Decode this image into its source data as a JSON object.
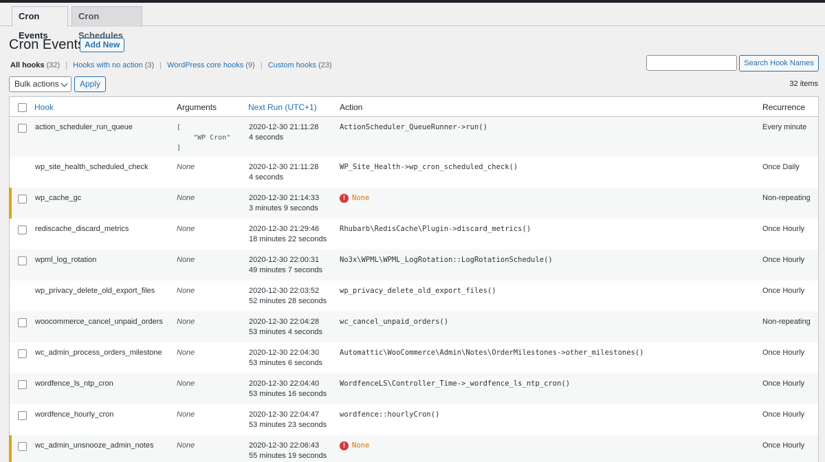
{
  "tabs": [
    {
      "label": "Cron Events",
      "active": true
    },
    {
      "label": "Cron Schedules",
      "active": false
    }
  ],
  "page": {
    "title": "Cron Events",
    "add_new": "Add New"
  },
  "filters": [
    {
      "label": "All hooks",
      "count": "(32)"
    },
    {
      "label": "Hooks with no action",
      "count": "(3)"
    },
    {
      "label": "WordPress core hooks",
      "count": "(9)"
    },
    {
      "label": "Custom hooks",
      "count": "(23)"
    }
  ],
  "search": {
    "button": "Search Hook Names",
    "value": ""
  },
  "bulk": {
    "label": "Bulk actions",
    "apply": "Apply"
  },
  "items_count": "32 items",
  "columns": {
    "hook": "Hook",
    "arguments": "Arguments",
    "next_run": "Next Run (UTC+1)",
    "action": "Action",
    "recurrence": "Recurrence"
  },
  "rows": [
    {
      "hook": "action_scheduler_run_queue",
      "args": "[\n    \"WP Cron\"\n]",
      "args_mono": true,
      "run": "2020-12-30 21:11:28",
      "rel": "4 seconds",
      "action": "ActionScheduler_QueueRunner->run()",
      "warn": false,
      "rec": "Every minute",
      "checkbox": true
    },
    {
      "hook": "wp_site_health_scheduled_check",
      "args": "None",
      "run": "2020-12-30 21:11:28",
      "rel": "4 seconds",
      "action": "WP_Site_Health->wp_cron_scheduled_check()",
      "warn": false,
      "rec": "Once Daily",
      "checkbox": false
    },
    {
      "hook": "wp_cache_gc",
      "args": "None",
      "run": "2020-12-30 21:14:33",
      "rel": "3 minutes 9 seconds",
      "action": "None",
      "warn": true,
      "rec": "Non-repeating",
      "checkbox": true
    },
    {
      "hook": "rediscache_discard_metrics",
      "args": "None",
      "run": "2020-12-30 21:29:46",
      "rel": "18 minutes 22 seconds",
      "action": "Rhubarb\\RedisCache\\Plugin->discard_metrics()",
      "warn": false,
      "rec": "Once Hourly",
      "checkbox": true
    },
    {
      "hook": "wpml_log_rotation",
      "args": "None",
      "run": "2020-12-30 22:00:31",
      "rel": "49 minutes 7 seconds",
      "action": "No3x\\WPML\\WPML_LogRotation::LogRotationSchedule()",
      "warn": false,
      "rec": "Once Hourly",
      "checkbox": true
    },
    {
      "hook": "wp_privacy_delete_old_export_files",
      "args": "None",
      "run": "2020-12-30 22:03:52",
      "rel": "52 minutes 28 seconds",
      "action": "wp_privacy_delete_old_export_files()",
      "warn": false,
      "rec": "Once Hourly",
      "checkbox": false
    },
    {
      "hook": "woocommerce_cancel_unpaid_orders",
      "args": "None",
      "run": "2020-12-30 22:04:28",
      "rel": "53 minutes 4 seconds",
      "action": "wc_cancel_unpaid_orders()",
      "warn": false,
      "rec": "Non-repeating",
      "checkbox": true
    },
    {
      "hook": "wc_admin_process_orders_milestone",
      "args": "None",
      "run": "2020-12-30 22:04:30",
      "rel": "53 minutes 6 seconds",
      "action": "Automattic\\WooCommerce\\Admin\\Notes\\OrderMilestones->other_milestones()",
      "warn": false,
      "rec": "Once Hourly",
      "checkbox": true
    },
    {
      "hook": "wordfence_ls_ntp_cron",
      "args": "None",
      "run": "2020-12-30 22:04:40",
      "rel": "53 minutes 16 seconds",
      "action": "WordfenceLS\\Controller_Time->_wordfence_ls_ntp_cron()",
      "warn": false,
      "rec": "Once Hourly",
      "checkbox": true
    },
    {
      "hook": "wordfence_hourly_cron",
      "args": "None",
      "run": "2020-12-30 22:04:47",
      "rel": "53 minutes 23 seconds",
      "action": "wordfence::hourlyCron()",
      "warn": false,
      "rec": "Once Hourly",
      "checkbox": true
    },
    {
      "hook": "wc_admin_unsnooze_admin_notes",
      "args": "None",
      "run": "2020-12-30 22:06:43",
      "rel": "55 minutes 19 seconds",
      "action": "None",
      "warn": true,
      "rec": "Once Hourly",
      "checkbox": true
    }
  ],
  "colors": {
    "link": "#2271b1",
    "warning": "#dba617",
    "error": "#d63638"
  },
  "icons": {
    "warning": "exclamation-circle-icon",
    "dropdown": "chevron-down-icon"
  }
}
